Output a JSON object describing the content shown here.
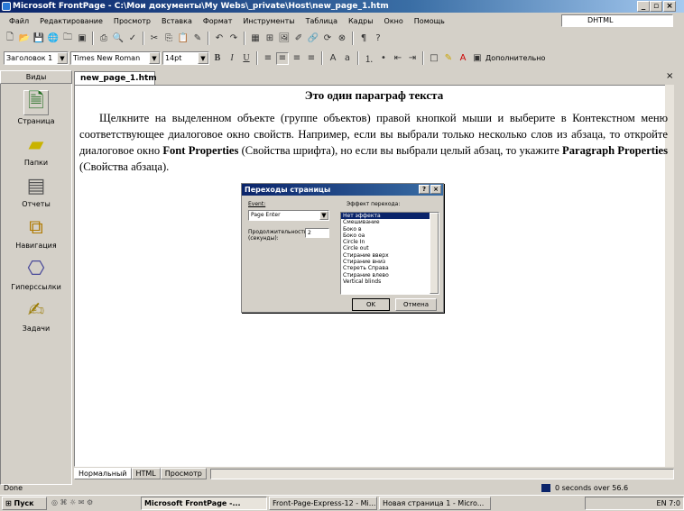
{
  "window": {
    "title": "Microsoft FrontPage - C:\\Мои документы\\My Webs\\_private\\Host\\new_page_1.htm",
    "min": "_",
    "max": "▫",
    "close": "×"
  },
  "menu": [
    "Файл",
    "Редактирование",
    "Просмотр",
    "Вставка",
    "Формат",
    "Инструменты",
    "Таблица",
    "Кадры",
    "Окно",
    "Помощь"
  ],
  "dhtml": "DHTML",
  "format_toolbar": {
    "style": "Заголовок 1",
    "font": "Times New Roman",
    "size": "14pt",
    "bold": "B",
    "italic": "I",
    "underline": "U",
    "more": "Дополнительно"
  },
  "views": {
    "title": "Виды",
    "items": [
      {
        "label": "Страница",
        "icon": "page-icon"
      },
      {
        "label": "Папки",
        "icon": "folder-icon"
      },
      {
        "label": "Отчеты",
        "icon": "reports-icon"
      },
      {
        "label": "Навигация",
        "icon": "navigation-icon"
      },
      {
        "label": "Гиперссылки",
        "icon": "hyperlinks-icon"
      },
      {
        "label": "Задачи",
        "icon": "tasks-icon"
      }
    ]
  },
  "editor": {
    "tab": "new_page_1.htm",
    "heading": "Это один параграф текста",
    "para": {
      "p1": "Щелкните на выделенном объекте (группе объектов) правой кнопкой мыши и выберите в Контекстном меню соответствующее диалоговое окно свойств. Например, если вы выбрали только несколько слов из абзаца, то откройте диалоговое окно ",
      "b1": "Font Properties",
      "p2": " (Свойства шрифта), но если вы выбрали целый абзац, то укажите ",
      "b2": "Paragraph Properties",
      "p3": " (Свойства абзаца)."
    }
  },
  "dialog": {
    "title": "Переходы страницы",
    "help": "?",
    "close": "×",
    "event_label": "Event:",
    "event_value": "Page Enter",
    "duration_label": "Продолжительность (секунды):",
    "duration_value": "2",
    "effect_label": "Эффект перехода:",
    "effects": [
      "Нет эффекта",
      "Смешивание",
      "Боко в",
      "Боко оа",
      "Circle In",
      "Circle out",
      "Стирание вверх",
      "Стирание вниз",
      "Стереть Справа",
      "Стирание влево",
      "Vertical blinds"
    ],
    "ok": "OK",
    "cancel": "Отмена"
  },
  "bottom_tabs": [
    "Нормальный",
    "HTML",
    "Просмотр"
  ],
  "status": {
    "left": "Done",
    "right": "0 seconds over 56.6"
  },
  "taskbar": {
    "start": "Пуск",
    "tasks": [
      "Microsoft FrontPage -...",
      "Front-Page-Express-12 - Mi...",
      "Новая страница 1 - Micro..."
    ],
    "clock": "7:0",
    "lang": "EN"
  }
}
